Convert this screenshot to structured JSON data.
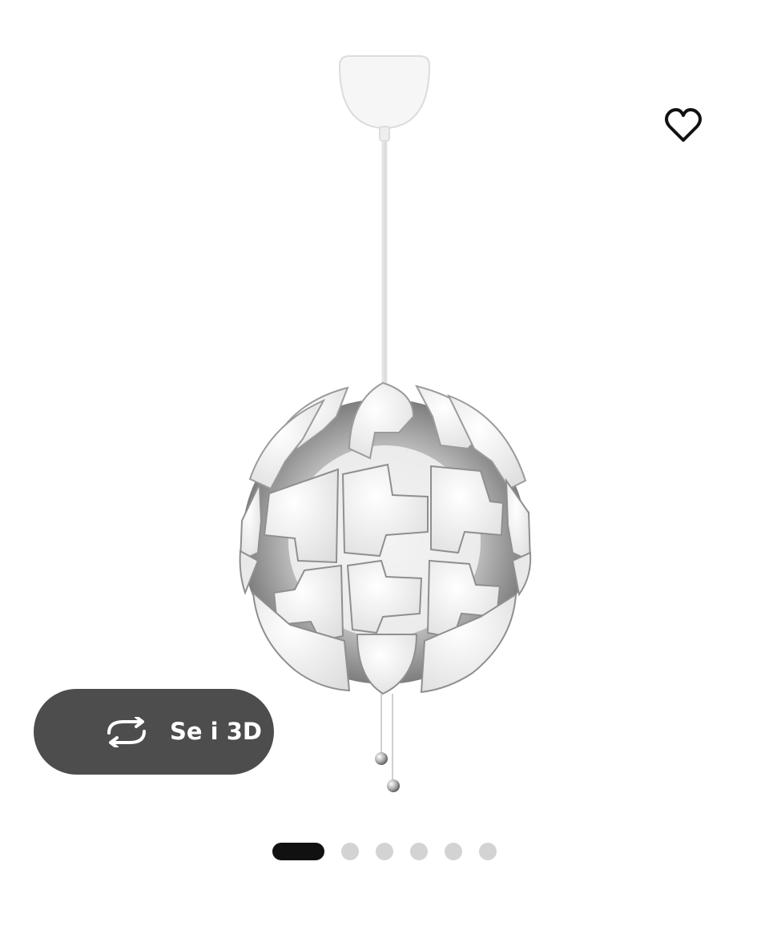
{
  "product_gallery": {
    "image_subject": "pendant-lamp",
    "favorite": {
      "icon": "heart-outline-icon",
      "color": "#111111"
    },
    "view_3d": {
      "label": "Se i 3D",
      "icon": "rotate-3d-icon",
      "background_color": "#4d4d4d",
      "text_color": "#ffffff"
    },
    "pagination": {
      "total": 6,
      "current": 1,
      "active_color": "#111111",
      "inactive_color": "#d3d3d3"
    }
  }
}
